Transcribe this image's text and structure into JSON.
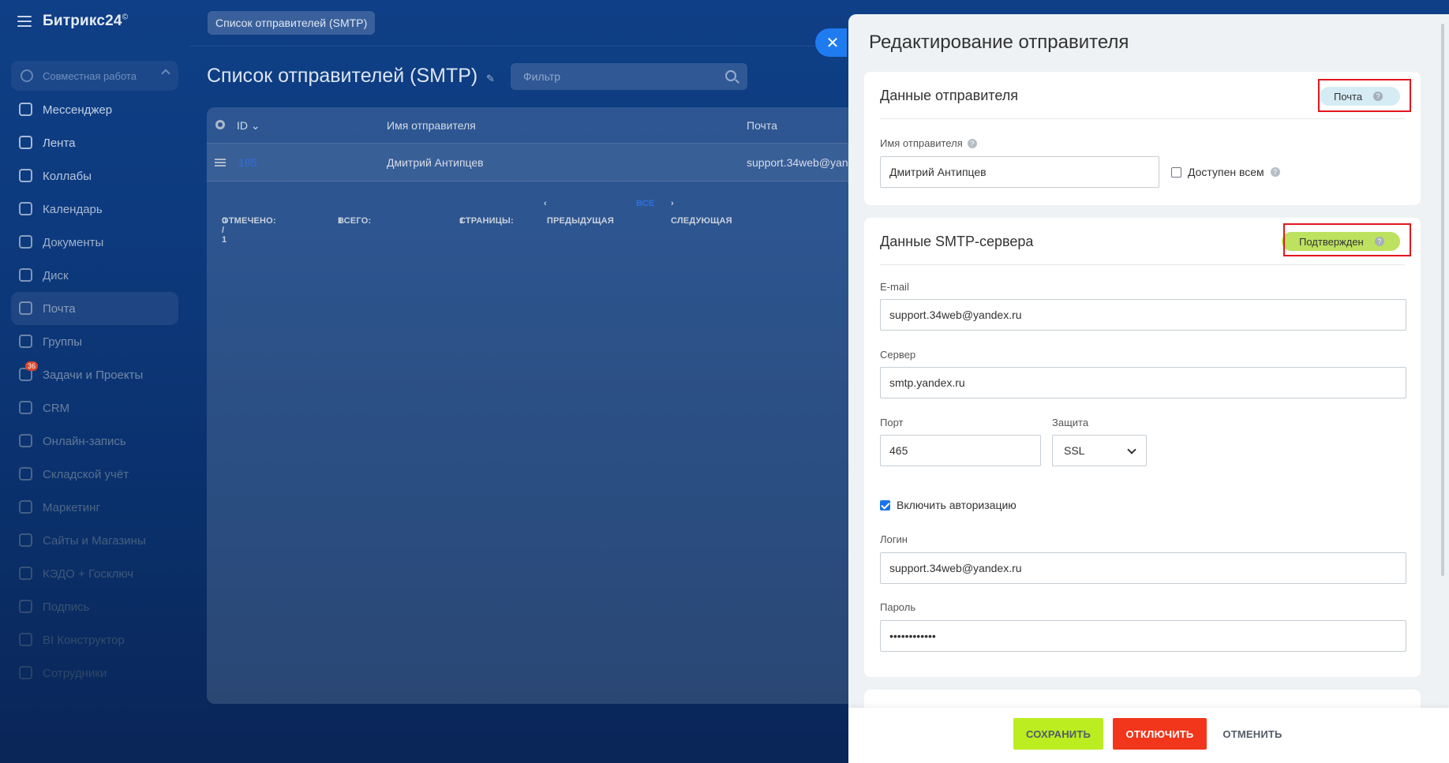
{
  "app": {
    "logo": "Битрикс24",
    "logo_mark": "©"
  },
  "sidebar": {
    "group_label": "Совместная работа",
    "items": [
      {
        "label": "Мессенджер",
        "color": "#c2d1e6"
      },
      {
        "label": "Лента",
        "color": "#c2d1e6"
      },
      {
        "label": "Коллабы",
        "color": "#b6c6dd"
      },
      {
        "label": "Календарь",
        "color": "#aabbd4"
      },
      {
        "label": "Документы",
        "color": "#9fb1cb"
      },
      {
        "label": "Диск",
        "color": "#94a7c3"
      },
      {
        "label": "Почта",
        "color": "#8a9dba"
      },
      {
        "label": "Группы",
        "color": "#7f93b1"
      },
      {
        "label": "Задачи и Проекты",
        "color": "#7489a8",
        "badge": "36"
      },
      {
        "label": "CRM",
        "color": "#697f9f"
      },
      {
        "label": "Онлайн-запись",
        "color": "#607797"
      },
      {
        "label": "Складской учёт",
        "color": "#566e8f"
      },
      {
        "label": "Маркетинг",
        "color": "#4d6687"
      },
      {
        "label": "Сайты и Магазины",
        "color": "#465f80"
      },
      {
        "label": "КЭДО + Госключ",
        "color": "#405879"
      },
      {
        "label": "Подпись",
        "color": "#3a5273"
      },
      {
        "label": "BI Конструктор",
        "color": "#344c6d"
      },
      {
        "label": "Сотрудники",
        "color": "#2f4767"
      }
    ]
  },
  "tab": {
    "label": "Список отправителей (SMTP)"
  },
  "page": {
    "title": "Список отправителей (SMTP)",
    "filter_placeholder": "Фильтр"
  },
  "grid": {
    "columns": {
      "id": "ID",
      "name": "Имя отправителя",
      "mail": "Почта"
    },
    "rows": [
      {
        "id": "185",
        "name": "Дмитрий Антипцев",
        "mail": "support.34web@yan"
      }
    ],
    "footer": {
      "selected_label": "ОТМЕЧЕНО:",
      "selected_value": "0 / 1",
      "total_label": "ВСЕГО:",
      "total_value": "1",
      "pages_label": "СТРАНИЦЫ:",
      "pages_value": "1",
      "prev": "ПРЕДЫДУЩАЯ",
      "all": "ВСЕ",
      "next": "СЛЕДУЮЩАЯ"
    }
  },
  "panel": {
    "title": "Редактирование отправителя",
    "sender": {
      "title": "Данные отправителя",
      "badge": "Почта",
      "name_label": "Имя отправителя",
      "name_value": "Дмитрий Антипцев",
      "public_label": "Доступен всем",
      "public_checked": false
    },
    "smtp": {
      "title": "Данные SMTP-сервера",
      "badge": "Подтвержден",
      "email_label": "E-mail",
      "email_value": "support.34web@yandex.ru",
      "server_label": "Сервер",
      "server_value": "smtp.yandex.ru",
      "port_label": "Порт",
      "port_value": "465",
      "security_label": "Защита",
      "security_value": "SSL",
      "auth_label": "Включить авторизацию",
      "auth_checked": true,
      "login_label": "Логин",
      "login_value": "support.34web@yandex.ru",
      "password_label": "Пароль",
      "password_value": "••••••••••••"
    },
    "buttons": {
      "save": "СОХРАНИТЬ",
      "disable": "ОТКЛЮЧИТЬ",
      "cancel": "ОТМЕНИТЬ"
    }
  },
  "colors": {
    "accent": "#1f7bf0",
    "save": "#bbed21",
    "disable": "#f1361b",
    "badge_mail": "#d6ecf5",
    "badge_ok": "#bde25f",
    "highlight": "#e3161e"
  }
}
